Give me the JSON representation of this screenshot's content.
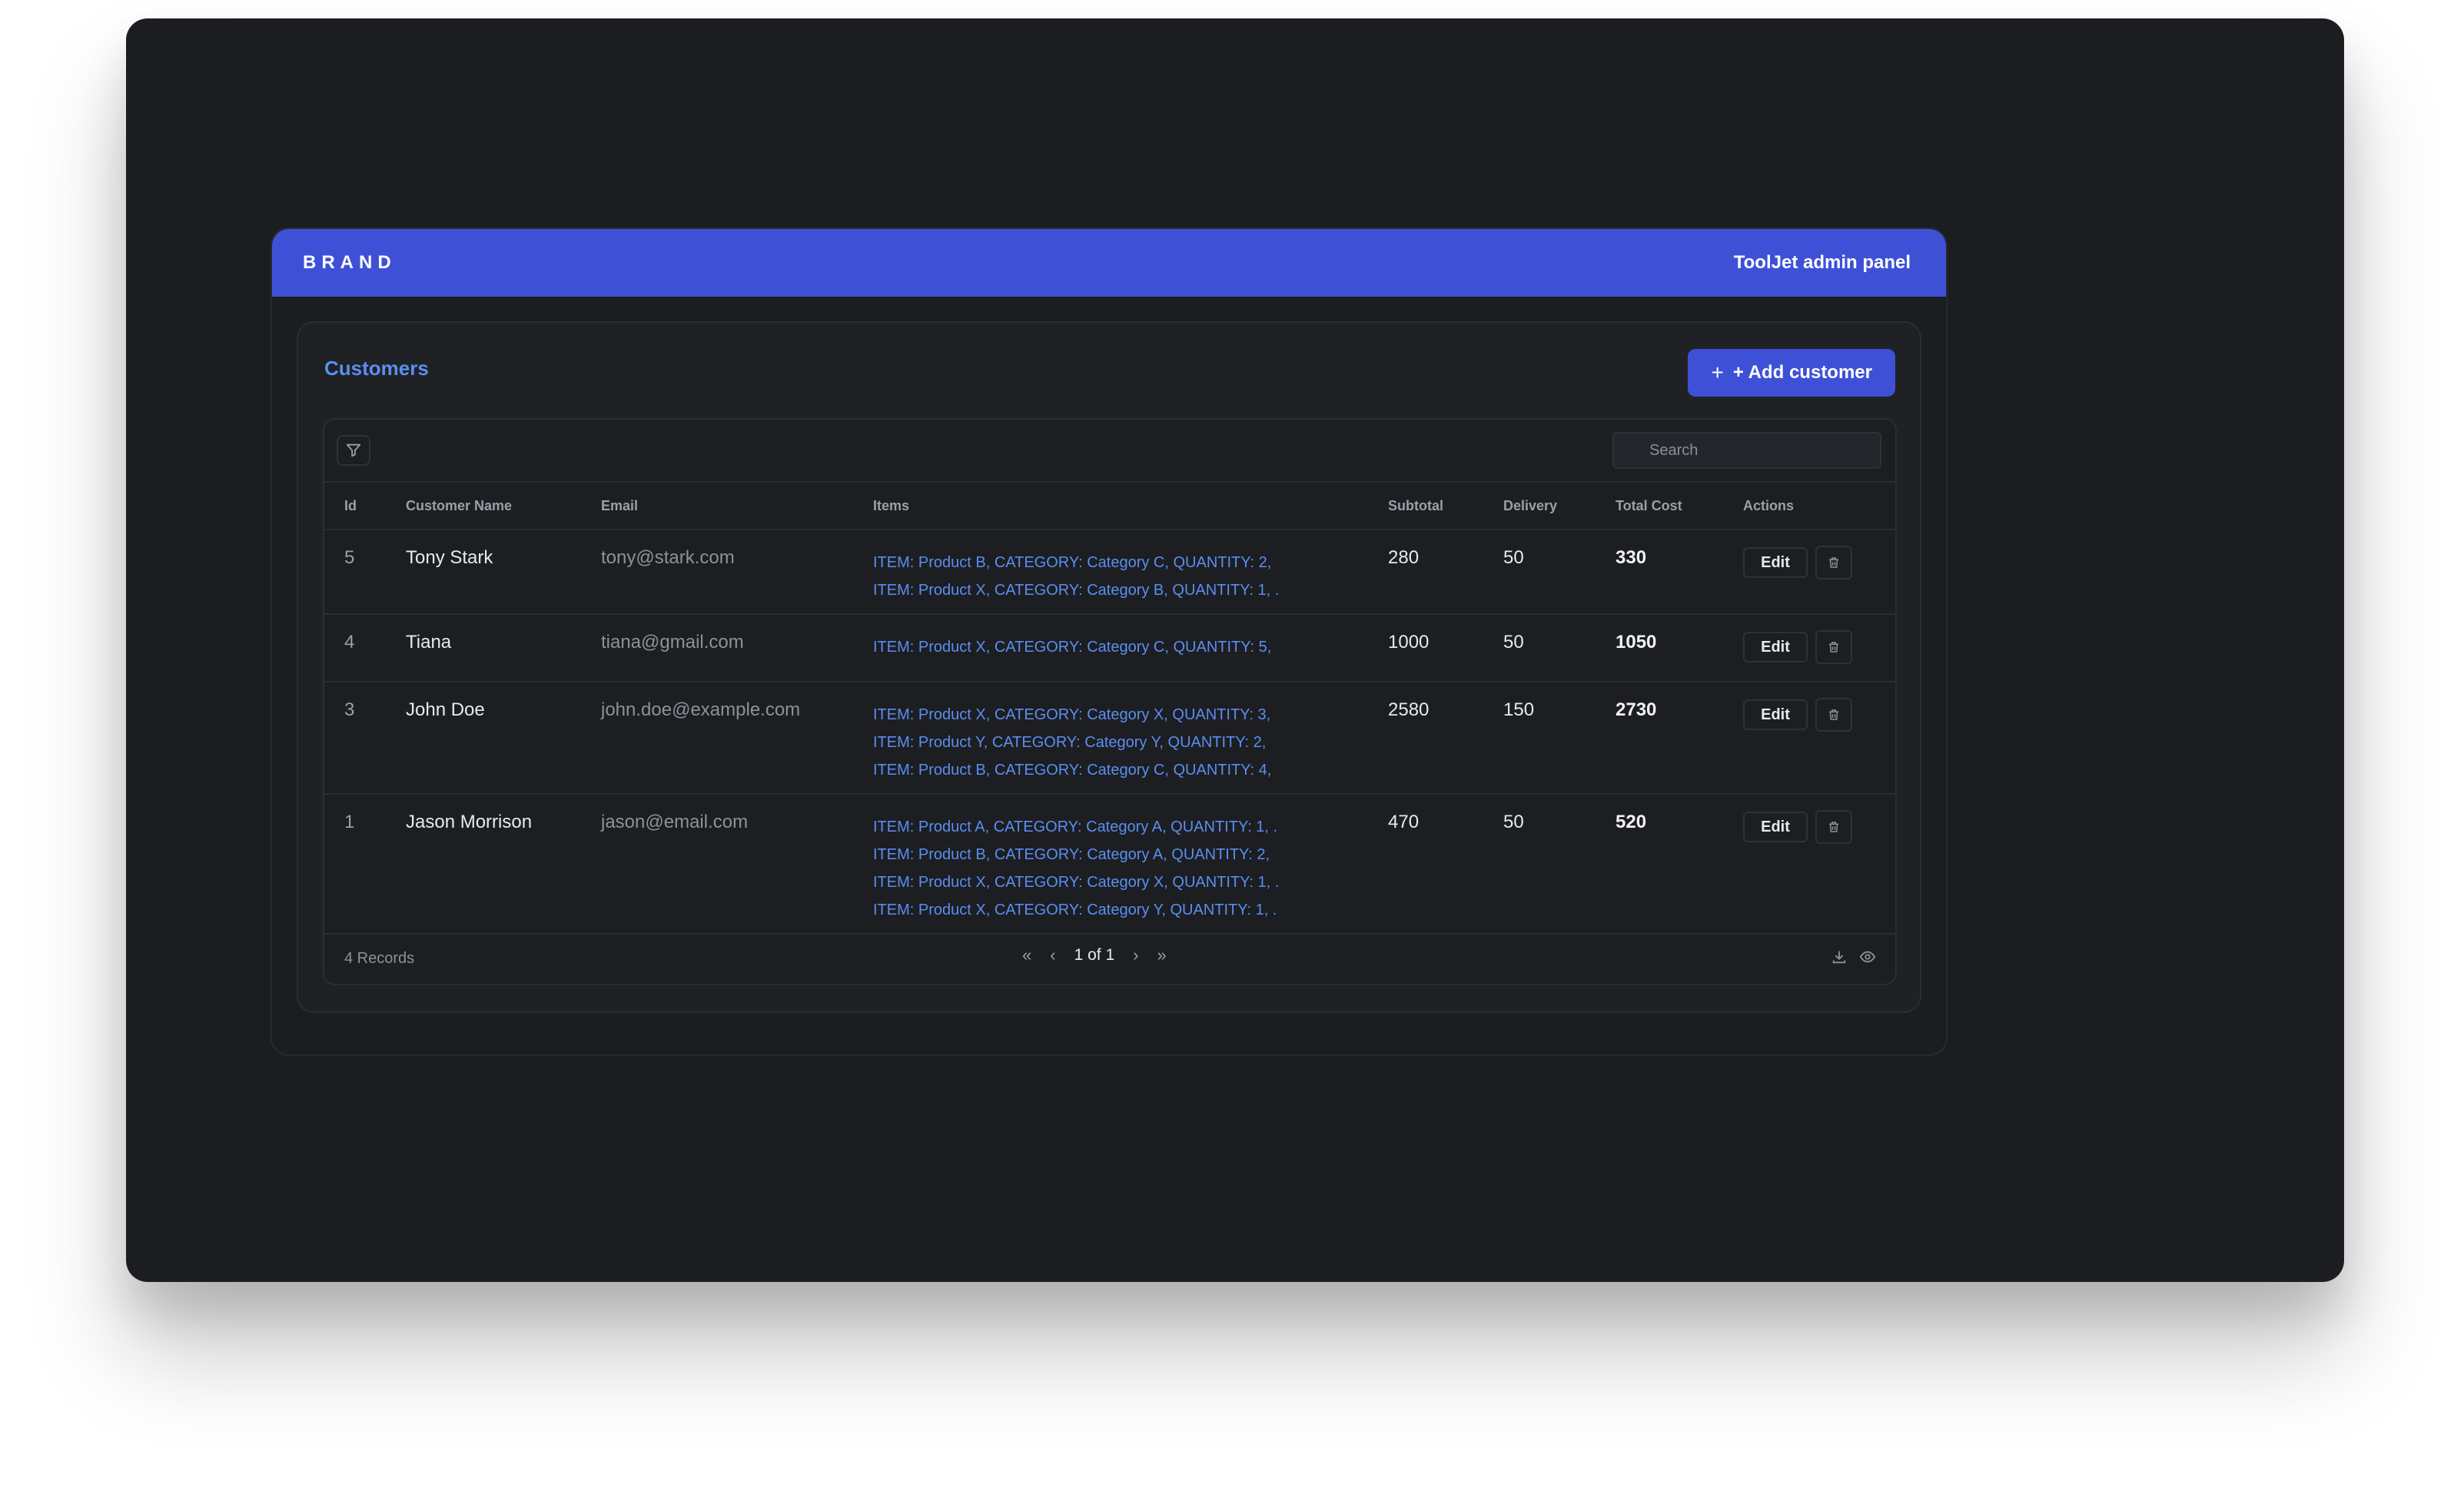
{
  "header": {
    "brand": "BRAND",
    "panel_title": "ToolJet admin panel"
  },
  "card": {
    "title": "Customers",
    "add_button": "+ Add customer"
  },
  "toolbar": {
    "search_placeholder": "Search"
  },
  "table": {
    "columns": [
      "Id",
      "Customer Name",
      "Email",
      "Items",
      "Subtotal",
      "Delivery",
      "Total Cost",
      "Actions"
    ],
    "rows": [
      {
        "id": "5",
        "name": "Tony Stark",
        "email": "tony@stark.com",
        "items": [
          "ITEM: Product B, CATEGORY: Category C, QUANTITY: 2,",
          "ITEM: Product X, CATEGORY: Category B, QUANTITY: 1, ."
        ],
        "subtotal": "280",
        "delivery": "50",
        "total": "330"
      },
      {
        "id": "4",
        "name": "Tiana",
        "email": "tiana@gmail.com",
        "items": [
          "ITEM: Product X, CATEGORY: Category C, QUANTITY: 5,"
        ],
        "subtotal": "1000",
        "delivery": "50",
        "total": "1050"
      },
      {
        "id": "3",
        "name": "John Doe",
        "email": "john.doe@example.com",
        "items": [
          "ITEM: Product X, CATEGORY: Category X, QUANTITY: 3,",
          "ITEM: Product Y, CATEGORY: Category Y, QUANTITY: 2,",
          "ITEM: Product B, CATEGORY: Category C, QUANTITY: 4,"
        ],
        "subtotal": "2580",
        "delivery": "150",
        "total": "2730"
      },
      {
        "id": "1",
        "name": "Jason Morrison",
        "email": "jason@email.com",
        "items": [
          "ITEM: Product A, CATEGORY: Category A, QUANTITY: 1, .",
          "ITEM: Product B, CATEGORY: Category A, QUANTITY: 2,",
          "ITEM: Product X, CATEGORY: Category X, QUANTITY: 1, .",
          "ITEM: Product X, CATEGORY: Category Y, QUANTITY: 1, ."
        ],
        "subtotal": "470",
        "delivery": "50",
        "total": "520"
      }
    ],
    "edit_label": "Edit"
  },
  "footer": {
    "records": "4 Records",
    "page": "1 of 1"
  },
  "icons": {
    "filter": "filter-icon",
    "search": "search-icon",
    "plus": "plus-icon",
    "trash": "trash-icon",
    "first": "chevrons-left-icon",
    "prev": "chevron-left-icon",
    "next": "chevron-right-icon",
    "last": "chevrons-right-icon",
    "download": "download-icon",
    "eye": "eye-icon"
  },
  "colors": {
    "accent": "#3e51d6",
    "link": "#5b8ef0",
    "background": "#1b1d21"
  }
}
